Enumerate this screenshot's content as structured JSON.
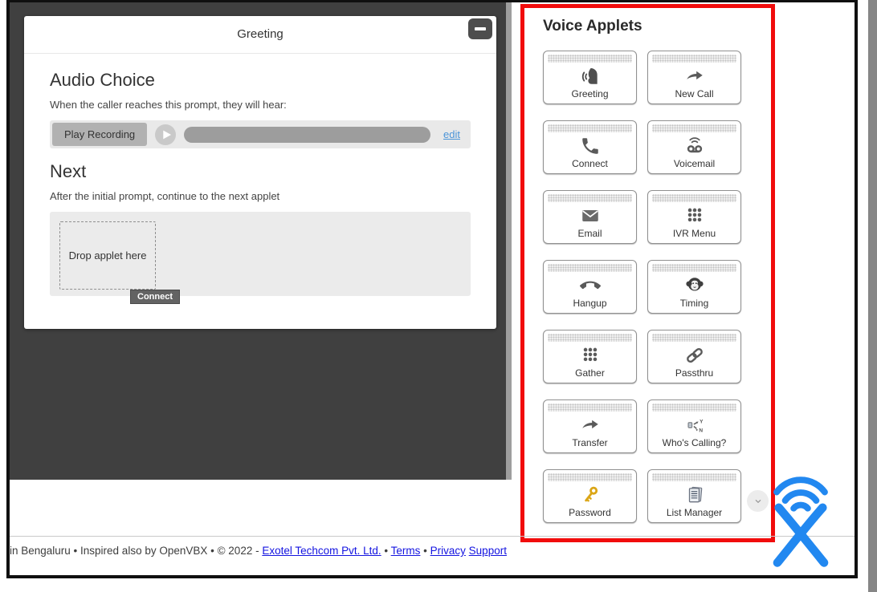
{
  "greeting_panel": {
    "title": "Greeting",
    "minimize_glyph": "minus",
    "audio_choice": {
      "heading": "Audio Choice",
      "description": "When the caller reaches this prompt, they will hear:",
      "play_button_label": "Play Recording",
      "edit_link": "edit"
    },
    "next": {
      "heading": "Next",
      "description": "After the initial prompt, continue to the next applet",
      "drop_placeholder": "Drop applet here",
      "drag_tooltip": "Connect"
    }
  },
  "applets_panel": {
    "title": "Voice Applets",
    "highlight_border_color": "#f10c0c",
    "applets": [
      {
        "label": "Greeting",
        "icon": "greeting-icon"
      },
      {
        "label": "New Call",
        "icon": "new-call-icon"
      },
      {
        "label": "Connect",
        "icon": "connect-icon"
      },
      {
        "label": "Voicemail",
        "icon": "voicemail-icon"
      },
      {
        "label": "Email",
        "icon": "email-icon"
      },
      {
        "label": "IVR Menu",
        "icon": "ivr-menu-icon"
      },
      {
        "label": "Hangup",
        "icon": "hangup-icon"
      },
      {
        "label": "Timing",
        "icon": "timing-icon"
      },
      {
        "label": "Gather",
        "icon": "gather-icon"
      },
      {
        "label": "Passthru",
        "icon": "passthru-icon"
      },
      {
        "label": "Transfer",
        "icon": "transfer-icon"
      },
      {
        "label": "Who's Calling?",
        "icon": "whos-calling-icon"
      },
      {
        "label": "Password",
        "icon": "password-icon"
      },
      {
        "label": "List Manager",
        "icon": "list-manager-icon"
      }
    ]
  },
  "footer": {
    "prefix": "in Bengaluru • Inspired also by OpenVBX • © 2022 - ",
    "link_company": "Exotel Techcom Pvt. Ltd.",
    "sep1": " • ",
    "link_terms": "Terms",
    "sep2": " • ",
    "link_privacy": "Privacy",
    "sep3": " ",
    "link_support": "Support"
  },
  "colors": {
    "canvas_dark": "#404040",
    "panel_highlight_red": "#f10c0c",
    "logo_blue": "#2288f0",
    "link_blue": "#1414e0",
    "edit_link_blue": "#4a94d8",
    "key_gold": "#dba617"
  }
}
